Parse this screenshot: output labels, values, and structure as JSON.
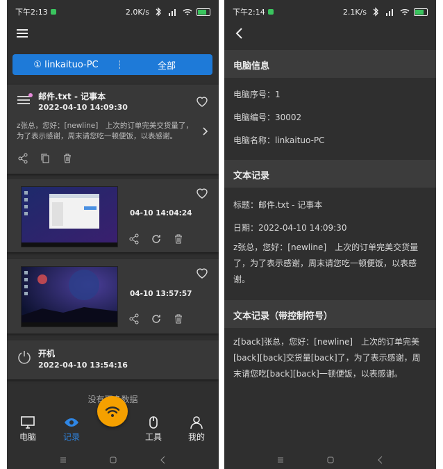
{
  "left": {
    "status": {
      "time": "下午2:13",
      "speed": "2.0K/s"
    },
    "tabs": {
      "current": "① linkaituo-PC",
      "all": "全部"
    },
    "items": [
      {
        "type": "text",
        "title": "邮件.txt - 记事本",
        "date": "2022-04-10 14:09:30",
        "body": "z张总，您好：[newline]　上次的订单完美交货量了，为了表示感谢，周末请您吃一顿便饭，以表感谢。"
      },
      {
        "type": "screenshot",
        "time": "04-10 14:04:24"
      },
      {
        "type": "screenshot",
        "time": "04-10 13:57:57"
      },
      {
        "type": "power",
        "title": "开机",
        "date": "2022-04-10 13:54:16"
      }
    ],
    "no_more": "没有更多数据",
    "nav": {
      "computer": "电脑",
      "records": "记录",
      "tools": "工具",
      "mine": "我的"
    }
  },
  "right": {
    "status": {
      "time": "下午2:14",
      "speed": "2.1K/s"
    },
    "pc_info": {
      "heading": "电脑信息",
      "serial": "电脑序号：1",
      "number": "电脑编号：30002",
      "name": "电脑名称：linkaituo-PC"
    },
    "text_record": {
      "heading": "文本记录",
      "title": "标题：邮件.txt - 记事本",
      "date": "日期：2022-04-10 14:09:30",
      "content": "z张总，您好：[newline]　上次的订单完美交货量了，为了表示感谢，周末请您吃一顿便饭，以表感谢。"
    },
    "text_record_ctrl": {
      "heading": "文本记录（带控制符号）",
      "content": "z[back]张总，您好：[newline]　上次的订单完美[back][back]交货量[back]了，为了表示感谢，周末请您吃[back][back]一顿便饭，以表感谢。"
    }
  },
  "colors": {
    "accent": "#1e7ad8",
    "active": "#2f86e4",
    "fab": "#f5a000",
    "background": "#2f2f2f"
  }
}
